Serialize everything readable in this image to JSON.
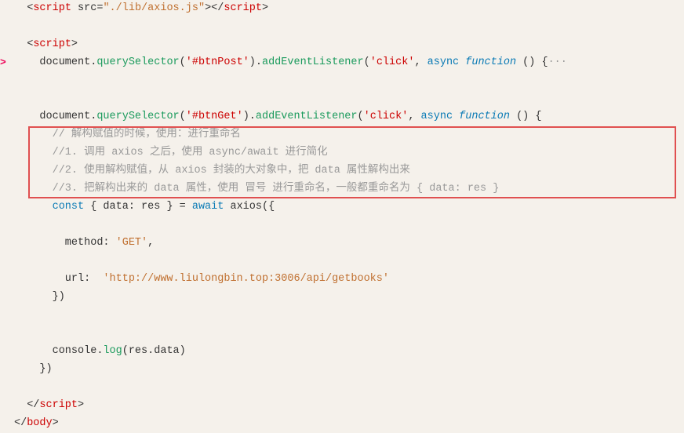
{
  "lines": [
    {
      "id": 1,
      "num": "",
      "arrow": "",
      "indent": 0,
      "tokens": [
        {
          "text": "  <",
          "cls": "kw-plain"
        },
        {
          "text": "script",
          "cls": "kw-tag"
        },
        {
          "text": " src=",
          "cls": "kw-plain"
        },
        {
          "text": "\"./lib/axios.js\"",
          "cls": "kw-string"
        },
        {
          "text": "></",
          "cls": "kw-plain"
        },
        {
          "text": "script",
          "cls": "kw-tag"
        },
        {
          "text": ">",
          "cls": "kw-plain"
        }
      ]
    },
    {
      "id": 2,
      "num": "",
      "arrow": "",
      "indent": 0,
      "tokens": [],
      "empty": true
    },
    {
      "id": 3,
      "num": "",
      "arrow": "",
      "indent": 0,
      "tokens": [
        {
          "text": "  <",
          "cls": "kw-plain"
        },
        {
          "text": "script",
          "cls": "kw-tag"
        },
        {
          "text": ">",
          "cls": "kw-plain"
        }
      ]
    },
    {
      "id": 4,
      "num": "",
      "arrow": ">",
      "indent": 0,
      "tokens": [
        {
          "text": "    document.",
          "cls": "kw-plain"
        },
        {
          "text": "querySelector",
          "cls": "kw-method"
        },
        {
          "text": "(",
          "cls": "kw-plain"
        },
        {
          "text": "'#btnPost'",
          "cls": "kw-selector"
        },
        {
          "text": ").",
          "cls": "kw-plain"
        },
        {
          "text": "addEventListener",
          "cls": "kw-method"
        },
        {
          "text": "(",
          "cls": "kw-plain"
        },
        {
          "text": "'click'",
          "cls": "kw-selector"
        },
        {
          "text": ", ",
          "cls": "kw-plain"
        },
        {
          "text": "async ",
          "cls": "kw-async"
        },
        {
          "text": "function",
          "cls": "kw-function"
        },
        {
          "text": " () {",
          "cls": "kw-plain"
        },
        {
          "text": "···",
          "cls": "kw-comment"
        }
      ]
    },
    {
      "id": 5,
      "num": "",
      "arrow": "",
      "indent": 0,
      "tokens": [],
      "empty": true
    },
    {
      "id": 6,
      "num": "",
      "arrow": "",
      "indent": 0,
      "tokens": [],
      "empty": true
    },
    {
      "id": 7,
      "num": "",
      "arrow": "",
      "indent": 0,
      "tokens": [
        {
          "text": "    document.",
          "cls": "kw-plain"
        },
        {
          "text": "querySelector",
          "cls": "kw-method"
        },
        {
          "text": "(",
          "cls": "kw-plain"
        },
        {
          "text": "'#btnGet'",
          "cls": "kw-selector"
        },
        {
          "text": ").",
          "cls": "kw-plain"
        },
        {
          "text": "addEventListener",
          "cls": "kw-method"
        },
        {
          "text": "(",
          "cls": "kw-plain"
        },
        {
          "text": "'click'",
          "cls": "kw-selector"
        },
        {
          "text": ", ",
          "cls": "kw-plain"
        },
        {
          "text": "async ",
          "cls": "kw-async"
        },
        {
          "text": "function",
          "cls": "kw-function"
        },
        {
          "text": " () {",
          "cls": "kw-plain"
        }
      ]
    },
    {
      "id": 8,
      "num": "",
      "arrow": "",
      "indent": 1,
      "tokens": [
        {
          "text": "      // 解构赋值的时候，使用：进行重命名",
          "cls": "kw-comment"
        }
      ],
      "highlight": true
    },
    {
      "id": 9,
      "num": "",
      "arrow": "",
      "indent": 1,
      "tokens": [
        {
          "text": "      //1. 调用 axios 之后，使用 async/await 进行简化",
          "cls": "kw-comment"
        }
      ],
      "highlight": true
    },
    {
      "id": 10,
      "num": "",
      "arrow": "",
      "indent": 1,
      "tokens": [
        {
          "text": "      //2. 使用解构赋值，从 axios 封装的大对象中，把 data 属性解构出来",
          "cls": "kw-comment"
        }
      ],
      "highlight": true
    },
    {
      "id": 11,
      "num": "",
      "arrow": "",
      "indent": 1,
      "tokens": [
        {
          "text": "      //3. 把解构出来的 data 属性，使用 冒号 进行重命名，一般都重命名为 { data: res }",
          "cls": "kw-comment"
        }
      ],
      "highlight": true
    },
    {
      "id": 12,
      "num": "",
      "arrow": "",
      "indent": 0,
      "tokens": [
        {
          "text": "      ",
          "cls": "kw-plain"
        },
        {
          "text": "const",
          "cls": "kw-const"
        },
        {
          "text": " { data: res } = ",
          "cls": "kw-plain"
        },
        {
          "text": "await",
          "cls": "kw-await"
        },
        {
          "text": " axios({",
          "cls": "kw-plain"
        }
      ]
    },
    {
      "id": 13,
      "num": "",
      "arrow": "",
      "indent": 0,
      "tokens": [],
      "empty": true
    },
    {
      "id": 14,
      "num": "",
      "arrow": "",
      "indent": 0,
      "tokens": [
        {
          "text": "        method: ",
          "cls": "kw-plain"
        },
        {
          "text": "'GET'",
          "cls": "kw-string"
        },
        {
          "text": ",",
          "cls": "kw-plain"
        }
      ]
    },
    {
      "id": 15,
      "num": "",
      "arrow": "",
      "indent": 0,
      "tokens": [],
      "empty": true
    },
    {
      "id": 16,
      "num": "",
      "arrow": "",
      "indent": 0,
      "tokens": [
        {
          "text": "        url:  ",
          "cls": "kw-plain"
        },
        {
          "text": "'http://www.liulongbin.top:3006/api/getbooks'",
          "cls": "kw-string2"
        }
      ]
    },
    {
      "id": 17,
      "num": "",
      "arrow": "",
      "indent": 0,
      "tokens": [
        {
          "text": "      })",
          "cls": "kw-plain"
        }
      ]
    },
    {
      "id": 18,
      "num": "",
      "arrow": "",
      "indent": 0,
      "tokens": [],
      "empty": true
    },
    {
      "id": 19,
      "num": "",
      "arrow": "",
      "indent": 0,
      "tokens": [],
      "empty": true
    },
    {
      "id": 20,
      "num": "",
      "arrow": "",
      "indent": 0,
      "tokens": [
        {
          "text": "      console.",
          "cls": "kw-plain"
        },
        {
          "text": "log",
          "cls": "kw-method"
        },
        {
          "text": "(res.data)",
          "cls": "kw-plain"
        }
      ]
    },
    {
      "id": 21,
      "num": "",
      "arrow": "",
      "indent": 0,
      "tokens": [
        {
          "text": "    })",
          "cls": "kw-plain"
        }
      ]
    },
    {
      "id": 22,
      "num": "",
      "arrow": "",
      "indent": 0,
      "tokens": [],
      "empty": true
    },
    {
      "id": 23,
      "num": "",
      "arrow": "",
      "indent": 0,
      "tokens": [
        {
          "text": "  </",
          "cls": "kw-plain"
        },
        {
          "text": "script",
          "cls": "kw-tag"
        },
        {
          "text": ">",
          "cls": "kw-plain"
        }
      ]
    },
    {
      "id": 24,
      "num": "",
      "arrow": "",
      "indent": 0,
      "tokens": [
        {
          "text": "</",
          "cls": "kw-plain"
        },
        {
          "text": "body",
          "cls": "kw-tag"
        },
        {
          "text": ">",
          "cls": "kw-plain"
        }
      ]
    }
  ],
  "highlight": {
    "startLine": 8,
    "endLine": 11,
    "color": "#e05050"
  }
}
